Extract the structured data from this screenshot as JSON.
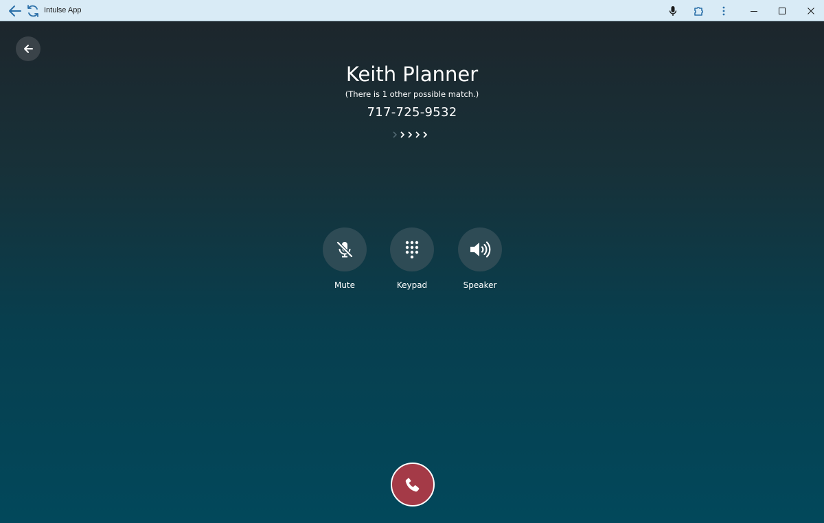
{
  "window": {
    "title": "Intulse App",
    "icons": [
      "back-arrow-icon",
      "refresh-icon",
      "microphone-icon",
      "extension-icon",
      "more-vertical-icon",
      "minimize-icon",
      "maximize-icon",
      "close-icon"
    ],
    "accent": "#2a6fa8"
  },
  "call": {
    "caller_name": "Keith Planner",
    "match_note": "(There is 1 other possible match.)",
    "phone_number": "717-725-9532",
    "status_arrows": [
      ">",
      ">",
      ">",
      ">",
      ">"
    ]
  },
  "actions": [
    {
      "label": "Mute",
      "icon": "microphone-muted-icon"
    },
    {
      "label": "Keypad",
      "icon": "keypad-icon"
    },
    {
      "label": "Speaker",
      "icon": "speaker-icon"
    }
  ],
  "colors": {
    "hangup": "#a43a47",
    "action_circle": "#2e4b55",
    "background_top": "#1d262c",
    "background_bottom": "#02485b"
  }
}
